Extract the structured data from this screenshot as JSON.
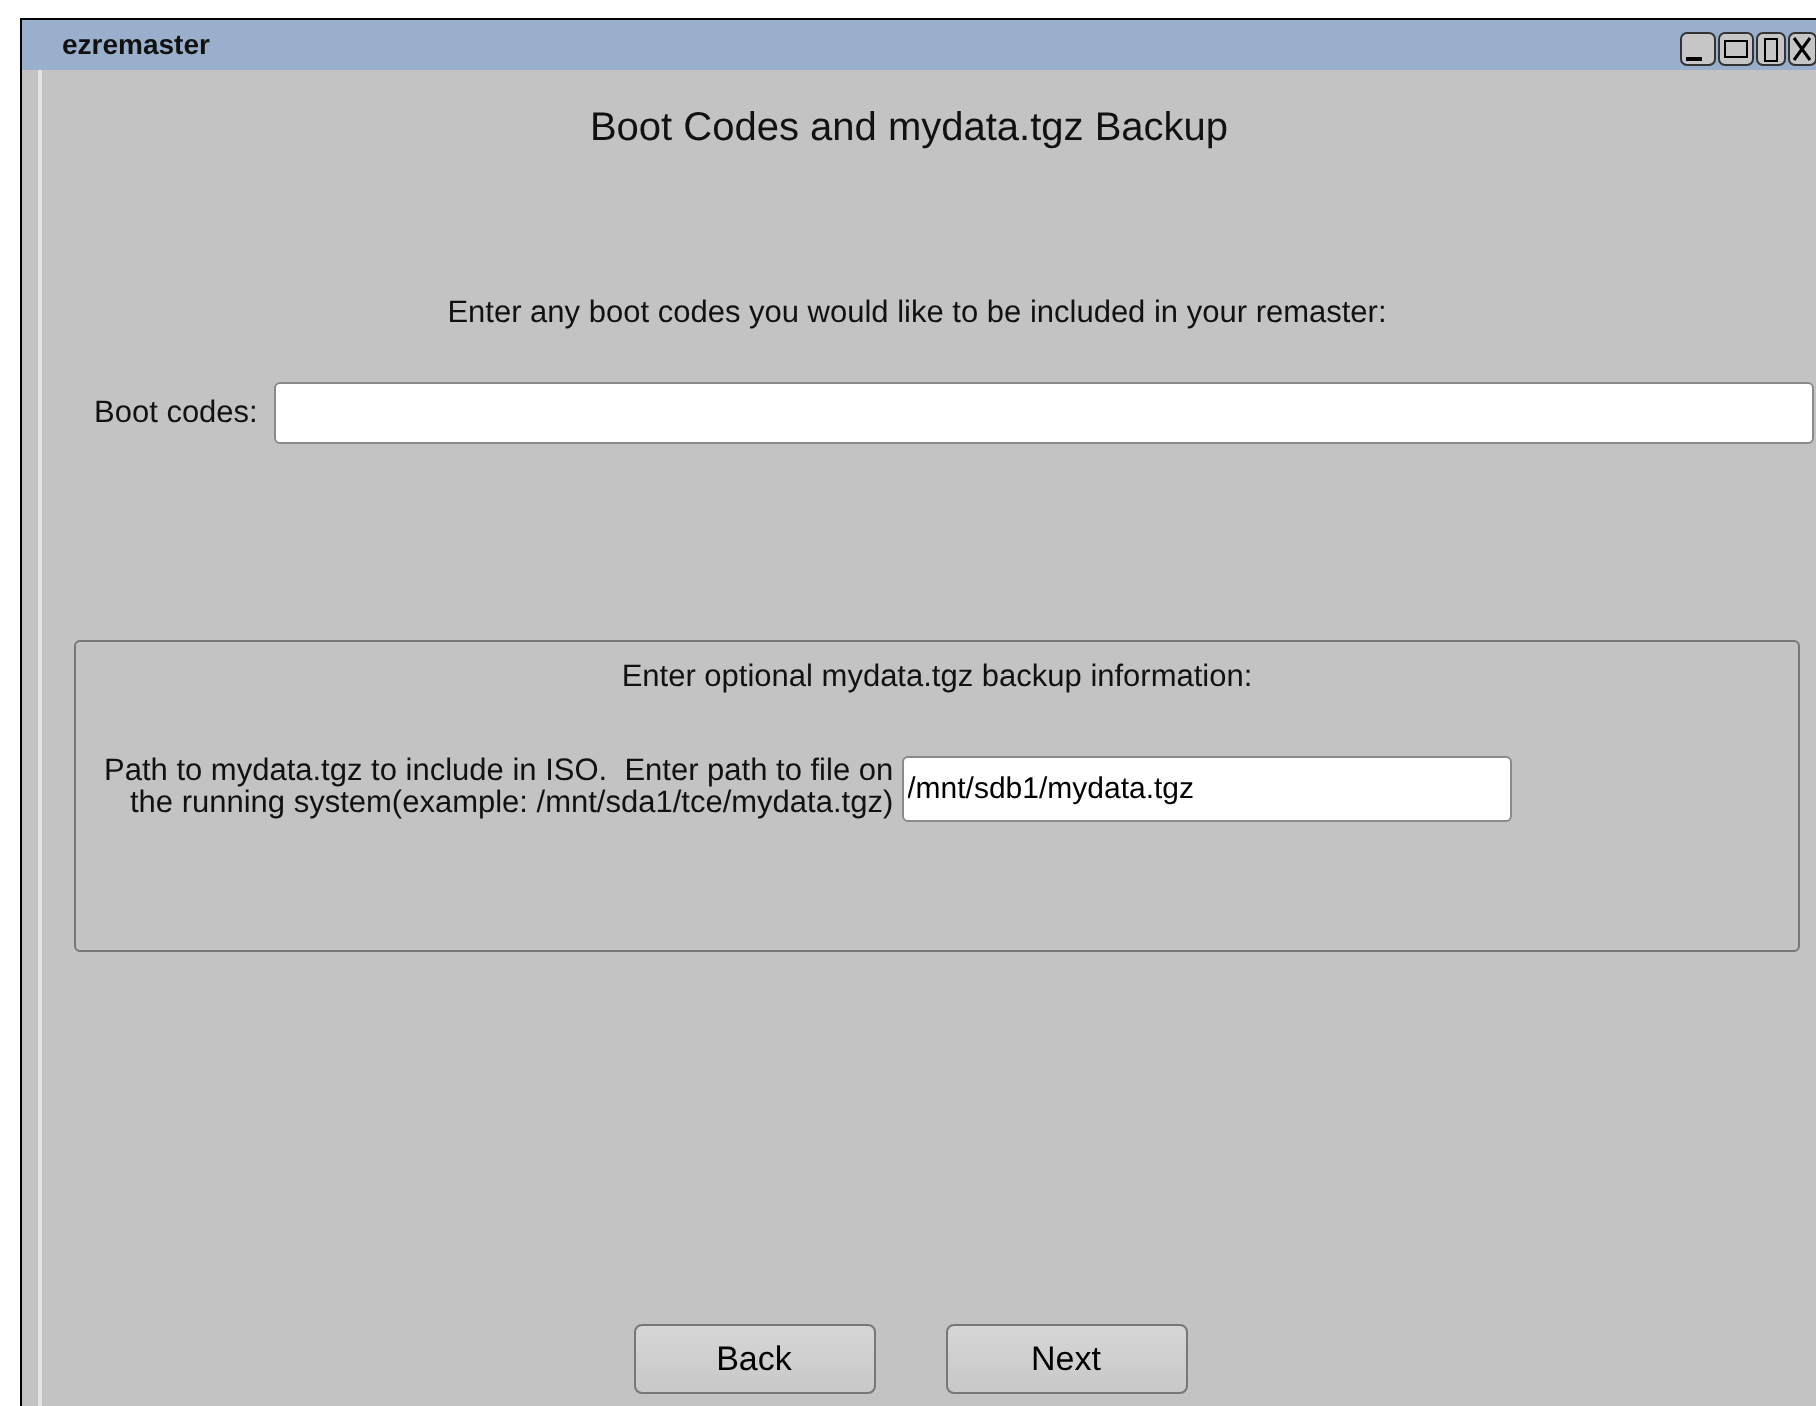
{
  "window": {
    "title": "ezremaster"
  },
  "heading": "Boot Codes and mydata.tgz Backup",
  "prompt": "Enter any boot codes you would like to be included in your remaster:",
  "boot_codes": {
    "label": "Boot codes:"
  },
  "backup": {
    "title": "Enter optional mydata.tgz backup information:",
    "path_label": "Path to mydata.tgz to include in ISO.  Enter path to file on\nthe running system(example: /mnt/sda1/tce/mydata.tgz)",
    "path_value": "/mnt/sdb1/mydata.tgz"
  },
  "buttons": [
    "Back",
    "Next"
  ]
}
